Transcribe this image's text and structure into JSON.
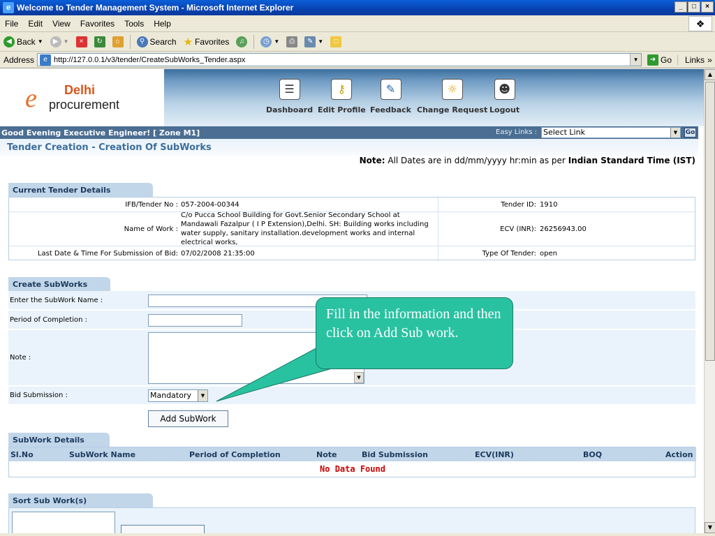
{
  "window": {
    "title": "Welcome to Tender Management System - Microsoft Internet Explorer",
    "controls": [
      "_",
      "×"
    ]
  },
  "menu": [
    "File",
    "Edit",
    "View",
    "Favorites",
    "Tools",
    "Help"
  ],
  "toolbar": {
    "back": "Back",
    "search": "Search",
    "favorites": "Favorites"
  },
  "address": {
    "label": "Address",
    "url": "http://127.0.0.1/v3/tender/CreateSubWorks_Tender.aspx",
    "go": "Go",
    "links": "Links"
  },
  "site": {
    "logo_top": "Delhi",
    "logo_bottom": "procurement",
    "nav": [
      "Dashboard",
      "Edit Profile",
      "Feedback",
      "Change Request",
      "Logout"
    ],
    "greeting": "Good Evening Executive Engineer!  [ Zone M1]",
    "easy_links_label": "Easy Links :",
    "easy_links_value": "Select Link",
    "easy_links_go": "Go"
  },
  "page": {
    "title": "Tender Creation - Creation Of SubWorks",
    "note_prefix": "Note:",
    "note_text": " All Dates are in dd/mm/yyyy hr:min as per ",
    "note_suffix": "Indian Standard Time (IST)"
  },
  "current_tender": {
    "tab": "Current Tender Details",
    "ifb_label": "IFB/Tender No :",
    "ifb_value": "057-2004-00344",
    "tender_id_label": "Tender ID:",
    "tender_id_value": "1910",
    "name_label": "Name of Work :",
    "name_value": "C/o Pucca School Building for Govt.Senior Secondary School at Mandawali Fazalpur ( I P Extension),Delhi. SH: Building works including water supply, sanitary installation.development works and internal electrical works,",
    "ecv_label": "ECV (INR):",
    "ecv_value": "26256943.00",
    "lastdate_label": "Last Date & Time For Submission of Bid:",
    "lastdate_value": "07/02/2008 21:35:00",
    "type_label": "Type Of Tender:",
    "type_value": "open"
  },
  "create_subworks": {
    "tab": "Create SubWorks",
    "name_label": "Enter the SubWork Name :",
    "period_label": "Period of Completion :",
    "note_label": "Note :",
    "bid_label": "Bid Submission :",
    "bid_value": "Mandatory",
    "add_button": "Add SubWork"
  },
  "subwork_details": {
    "tab": "SubWork Details",
    "columns": [
      "Sl.No",
      "SubWork Name",
      "Period of Completion",
      "Note",
      "Bid Submission",
      "ECV(INR)",
      "BOQ",
      "Action"
    ],
    "empty": "No Data Found"
  },
  "sort": {
    "tab": "Sort Sub Work(s)"
  },
  "callout": {
    "text": "Fill in the information and then click on Add Sub work."
  }
}
